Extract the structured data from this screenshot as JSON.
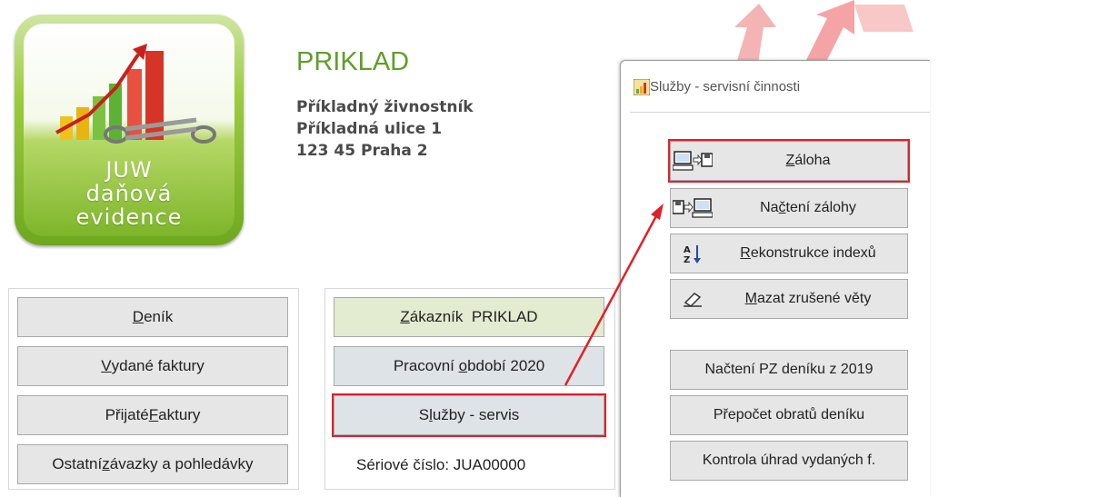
{
  "logo": {
    "line1": "JUW",
    "line2": "daňová",
    "line3": "evidence"
  },
  "company": {
    "name": "PRIKLAD",
    "owner": "Příkladný živnostník",
    "street": "Příkladná ulice 1",
    "city": "123 45 Praha 2"
  },
  "main_menu": [
    {
      "pre": "",
      "key": "D",
      "post": "eník"
    },
    {
      "pre": "",
      "key": "V",
      "post": "ydané faktury"
    },
    {
      "pre": "Přijaté ",
      "key": "F",
      "post": "aktury"
    },
    {
      "pre": "Ostatní ",
      "key": "z",
      "post": "ávazky a pohledávky"
    }
  ],
  "right_menu": {
    "customer": {
      "pre": "",
      "key": "Z",
      "post": "ákazník  PRIKLAD"
    },
    "period": {
      "pre": "Pracovní ",
      "key": "o",
      "post": "bdobí 2020"
    },
    "services": {
      "pre": "S",
      "key": "l",
      "post": "užby - servis"
    }
  },
  "serial": "Sériové číslo: JUA00000",
  "dialog": {
    "title": "Služby - servisní činnosti",
    "buttons": [
      {
        "pre": "",
        "key": "Z",
        "post": "áloha",
        "icon": "pc-to-disk-icon"
      },
      {
        "pre": "Na",
        "key": "č",
        "post": "tení zálohy",
        "icon": "disk-to-pc-icon"
      },
      {
        "pre": "",
        "key": "R",
        "post": "ekonstrukce indexů",
        "icon": "sort-az-icon"
      },
      {
        "pre": "",
        "key": "M",
        "post": "azat zrušené věty",
        "icon": "eraser-icon"
      },
      {
        "pre": "Načtení PZ deníku z 2019",
        "key": "",
        "post": ""
      },
      {
        "pre": "Přepočet obratů deníku",
        "key": "",
        "post": ""
      },
      {
        "pre": "Kontrola úhrad vydaných f.",
        "key": "",
        "post": ""
      }
    ]
  },
  "colors": {
    "highlight": "#e0202a",
    "brand_green": "#5f9e2a",
    "customer_button": "#e3ebd0",
    "period_button": "#dde3e6"
  }
}
